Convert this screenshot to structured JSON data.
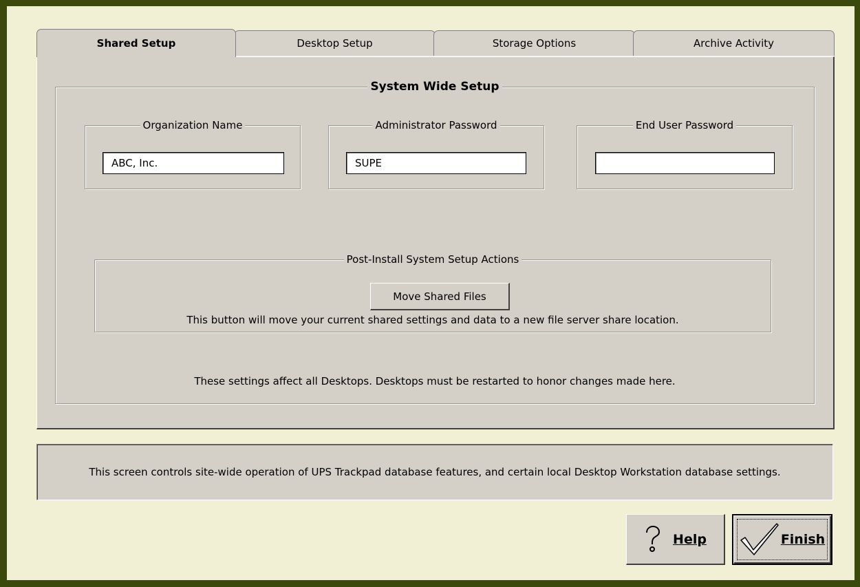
{
  "tabs": [
    {
      "label": "Shared Setup",
      "active": true
    },
    {
      "label": "Desktop Setup",
      "active": false
    },
    {
      "label": "Storage Options",
      "active": false
    },
    {
      "label": "Archive Activity",
      "active": false
    }
  ],
  "system_wide": {
    "title": "System Wide Setup",
    "org_name": {
      "label": "Organization Name",
      "value": "ABC, Inc."
    },
    "admin_password": {
      "label": "Administrator Password",
      "value": "SUPE"
    },
    "end_user_password": {
      "label": "End User Password",
      "value": ""
    },
    "post_install": {
      "title": "Post-Install System Setup Actions",
      "button_label": "Move Shared Files",
      "description": "This button will move your current shared settings and data to a new file server share location."
    },
    "footer_note": "These settings affect all Desktops.  Desktops must be restarted to honor changes made here."
  },
  "status_text": "This screen controls site-wide operation of UPS Trackpad database features, and certain local Desktop Workstation database settings.",
  "buttons": {
    "help_label": "Help",
    "finish_label": "Finish"
  },
  "icons": {
    "help": "question-mark-icon",
    "finish": "checkmark-icon"
  }
}
